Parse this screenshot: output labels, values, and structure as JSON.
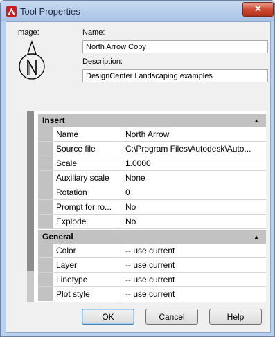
{
  "window": {
    "title": "Tool Properties",
    "close_glyph": "✕"
  },
  "header": {
    "image_label": "Image:",
    "name_label": "Name:",
    "name_value": "North Arrow Copy",
    "description_label": "Description:",
    "description_value": "DesignCenter Landscaping examples",
    "preview_icon": "north-arrow-icon"
  },
  "categories": [
    {
      "title": "Insert",
      "rows": [
        {
          "name": "Name",
          "value": "North Arrow"
        },
        {
          "name": "Source file",
          "value": "C:\\Program Files\\Autodesk\\Auto..."
        },
        {
          "name": "Scale",
          "value": "1.0000"
        },
        {
          "name": "Auxiliary scale",
          "value": "None"
        },
        {
          "name": "Rotation",
          "value": "0"
        },
        {
          "name": "Prompt for ro...",
          "value": "No"
        },
        {
          "name": "Explode",
          "value": "No"
        }
      ]
    },
    {
      "title": "General",
      "rows": [
        {
          "name": "Color",
          "value": "-- use current"
        },
        {
          "name": "Layer",
          "value": "-- use current"
        },
        {
          "name": "Linetype",
          "value": "-- use current"
        },
        {
          "name": "Plot style",
          "value": "-- use current"
        }
      ]
    }
  ],
  "buttons": {
    "ok": "OK",
    "cancel": "Cancel",
    "help": "Help"
  },
  "colors": {
    "accent": "#d11a1a",
    "category_bg": "#c2c2c2",
    "close": "#cf4a32"
  }
}
